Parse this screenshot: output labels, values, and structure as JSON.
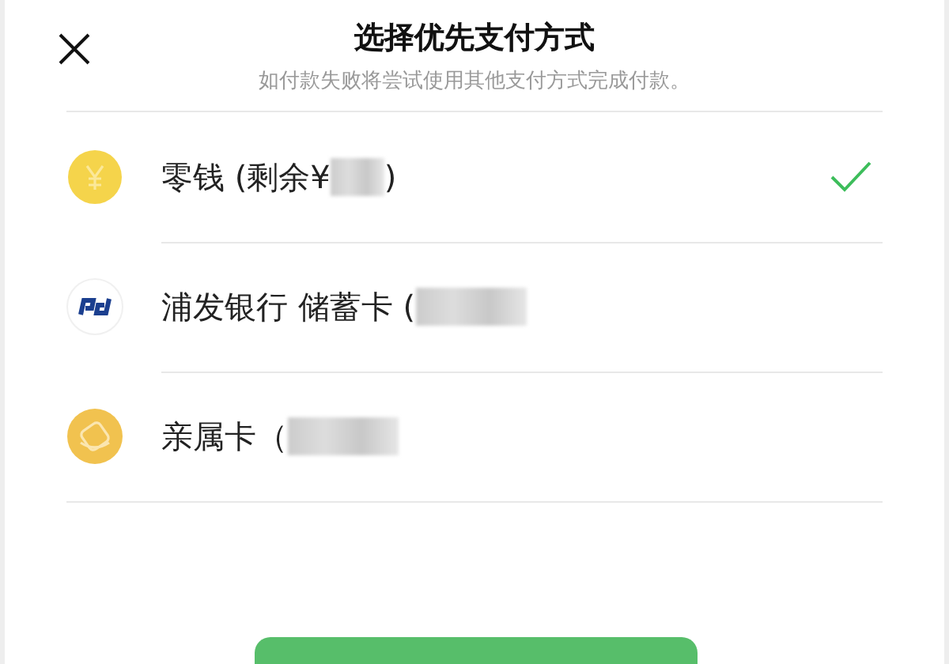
{
  "header": {
    "title": "选择优先支付方式",
    "subtitle": "如付款失败将尝试使用其他支付方式完成付款。"
  },
  "methods": [
    {
      "kind": "balance",
      "label": "零钱 (剩余¥",
      "suffix": ")",
      "selected": true
    },
    {
      "kind": "bank",
      "label": "浦发银行 储蓄卡 (",
      "selected": false
    },
    {
      "kind": "family",
      "label": "亲属卡（",
      "selected": false
    }
  ]
}
